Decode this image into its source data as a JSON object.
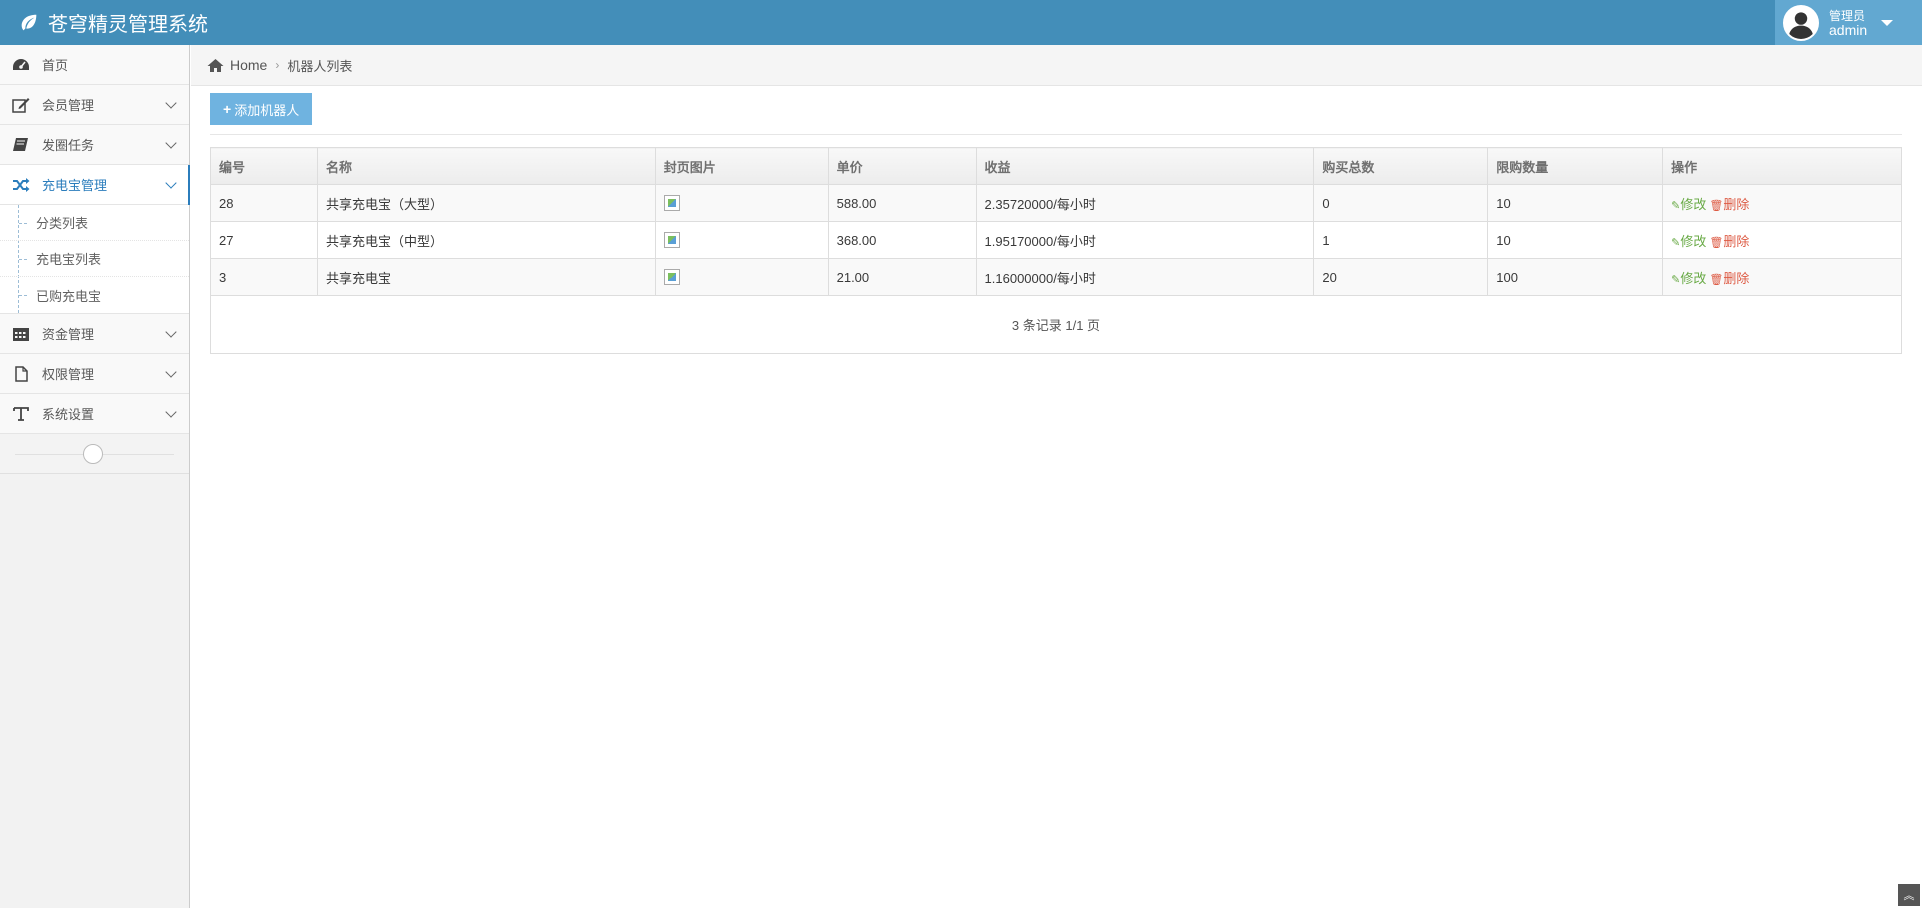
{
  "app": {
    "title": "苍穹精灵管理系统"
  },
  "user": {
    "role": "管理员",
    "name": "admin"
  },
  "sidebar": {
    "items": [
      {
        "label": "首页",
        "icon": "dashboard-icon"
      },
      {
        "label": "会员管理",
        "icon": "edit-icon"
      },
      {
        "label": "发圈任务",
        "icon": "book-icon"
      },
      {
        "label": "充电宝管理",
        "icon": "shuffle-icon"
      },
      {
        "label": "资金管理",
        "icon": "calendar-icon"
      },
      {
        "label": "权限管理",
        "icon": "file-icon"
      },
      {
        "label": "系统设置",
        "icon": "text-icon"
      }
    ],
    "submenu": [
      {
        "label": "分类列表"
      },
      {
        "label": "充电宝列表"
      },
      {
        "label": "已购充电宝"
      }
    ]
  },
  "breadcrumb": {
    "home": "Home",
    "current": "机器人列表"
  },
  "toolbar": {
    "add_label": "添加机器人"
  },
  "table": {
    "headers": [
      "编号",
      "名称",
      "封页图片",
      "单价",
      "收益",
      "购买总数",
      "限购数量",
      "操作"
    ],
    "rows": [
      {
        "id": "28",
        "name": "共享充电宝（大型）",
        "price": "588.00",
        "income": "2.35720000/每小时",
        "bought": "0",
        "limit": "10"
      },
      {
        "id": "27",
        "name": "共享充电宝（中型）",
        "price": "368.00",
        "income": "1.95170000/每小时",
        "bought": "1",
        "limit": "10"
      },
      {
        "id": "3",
        "name": "共享充电宝",
        "price": "21.00",
        "income": "1.16000000/每小时",
        "bought": "20",
        "limit": "100"
      }
    ],
    "edit_label": "修改",
    "delete_label": "删除"
  },
  "pagination": {
    "summary": "3 条记录 1/1 页"
  }
}
